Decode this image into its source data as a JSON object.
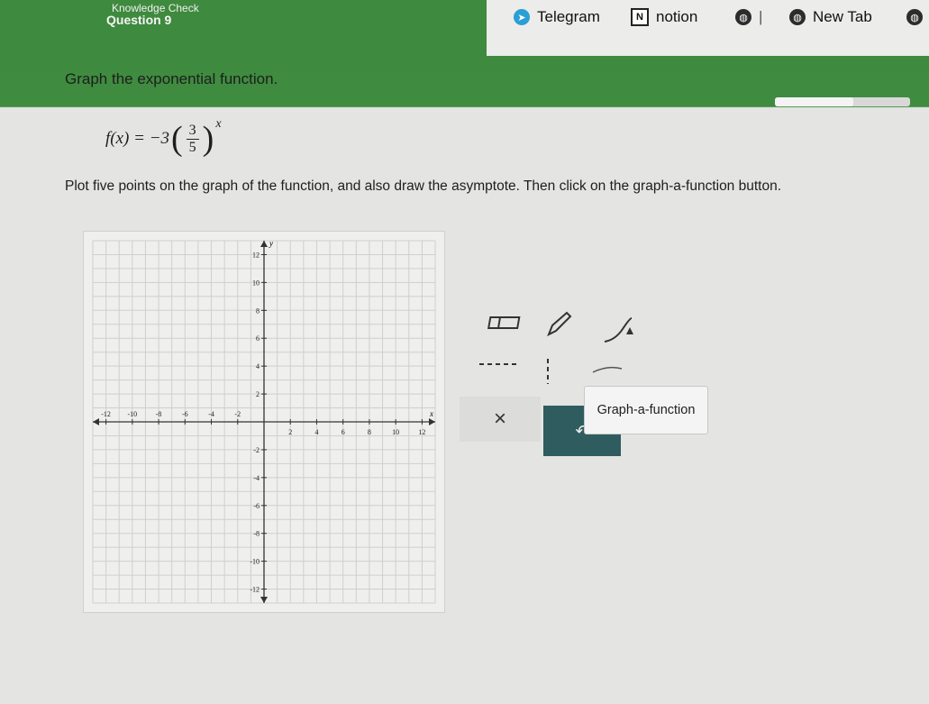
{
  "header": {
    "knowledge_check": "Knowledge Check",
    "question": "Question 9"
  },
  "bookmarks": [
    {
      "label": "Telegram",
      "icon": "telegram-icon"
    },
    {
      "label": "notion",
      "icon": "notion-icon",
      "glyph": "N"
    },
    {
      "label": "",
      "icon": "globe-icon"
    },
    {
      "label": "New Tab",
      "icon": "new-tab-icon"
    },
    {
      "label": "",
      "icon": "globe-icon"
    }
  ],
  "question": {
    "prompt": "Graph the exponential function.",
    "formula_lhs": "f(x) = −3",
    "fraction_num": "3",
    "fraction_den": "5",
    "exponent": "x",
    "instructions": "Plot five points on the graph of the function, and also draw the asymptote. Then click on the graph-a-function button."
  },
  "graph": {
    "x_label": "x",
    "y_label": "y",
    "x_ticks": [
      "-12",
      "-10",
      "-8",
      "-6",
      "-4",
      "-2",
      "2",
      "4",
      "6",
      "8",
      "10",
      "12"
    ],
    "y_ticks": [
      "12",
      "10",
      "8",
      "6",
      "4",
      "2",
      "-2",
      "-4",
      "-6",
      "-8",
      "-10",
      "-12"
    ],
    "xlim": [
      -13,
      13
    ],
    "ylim": [
      -13,
      13
    ]
  },
  "tools": {
    "eraser_icon": "eraser-icon",
    "pencil_icon": "pencil-icon",
    "exponential_icon": "exponential-curve-icon",
    "horizontal_dash_icon": "horizontal-asymptote-icon",
    "vertical_dash_icon": "vertical-asymptote-icon",
    "clear_label": "×",
    "undo_label": "↶",
    "tooltip": "Graph-a-function"
  },
  "colors": {
    "header_green": "#3e8a3e",
    "undo_button": "#2f5c5e"
  }
}
